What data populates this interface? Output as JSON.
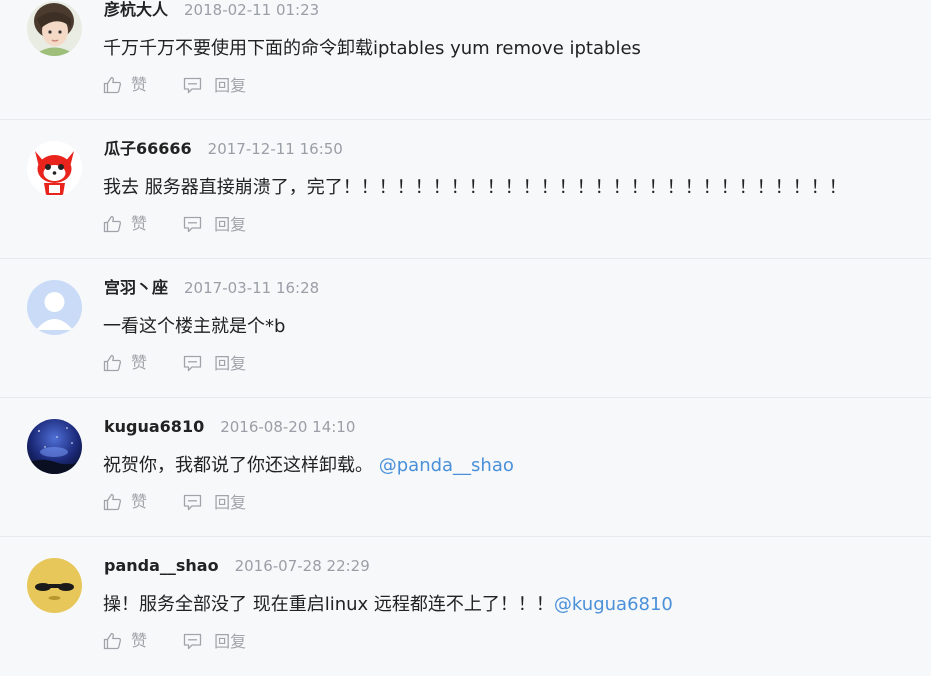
{
  "comments": [
    {
      "name": "彦杭大人",
      "time": "2018-02-11 01:23",
      "text": "千万千万不要使用下面的命令卸载iptables yum remove iptables",
      "mention": "",
      "avatar": "photo-girl",
      "like_label": "赞",
      "reply_label": "回复"
    },
    {
      "name": "瓜子66666",
      "time": "2017-12-11 16:50",
      "text": "我去 服务器直接崩溃了，完了！！！！！！！！！！！！！！！！！！！！！！！！！！！！",
      "mention": "",
      "avatar": "cartoon-fox",
      "like_label": "赞",
      "reply_label": "回复"
    },
    {
      "name": "宫羽丶座",
      "time": "2017-03-11 16:28",
      "text": "一看这个楼主就是个*b",
      "mention": "",
      "avatar": "default-user",
      "like_label": "赞",
      "reply_label": "回复"
    },
    {
      "name": "kugua6810",
      "time": "2016-08-20 14:10",
      "text": "祝贺你，我都说了你还这样卸载。",
      "mention": "@panda__shao",
      "avatar": "night-sky",
      "like_label": "赞",
      "reply_label": "回复"
    },
    {
      "name": "panda__shao",
      "time": "2016-07-28 22:29",
      "text": "操！服务全部没了 现在重启linux 远程都连不上了！！！",
      "mention": "@kugua6810",
      "avatar": "yellow-face",
      "like_label": "赞",
      "reply_label": "回复"
    }
  ],
  "colors": {
    "background": "#f7f8fa",
    "mention": "#4a90d9",
    "meta": "#9a9ea6",
    "divider": "#e8e9ec"
  }
}
